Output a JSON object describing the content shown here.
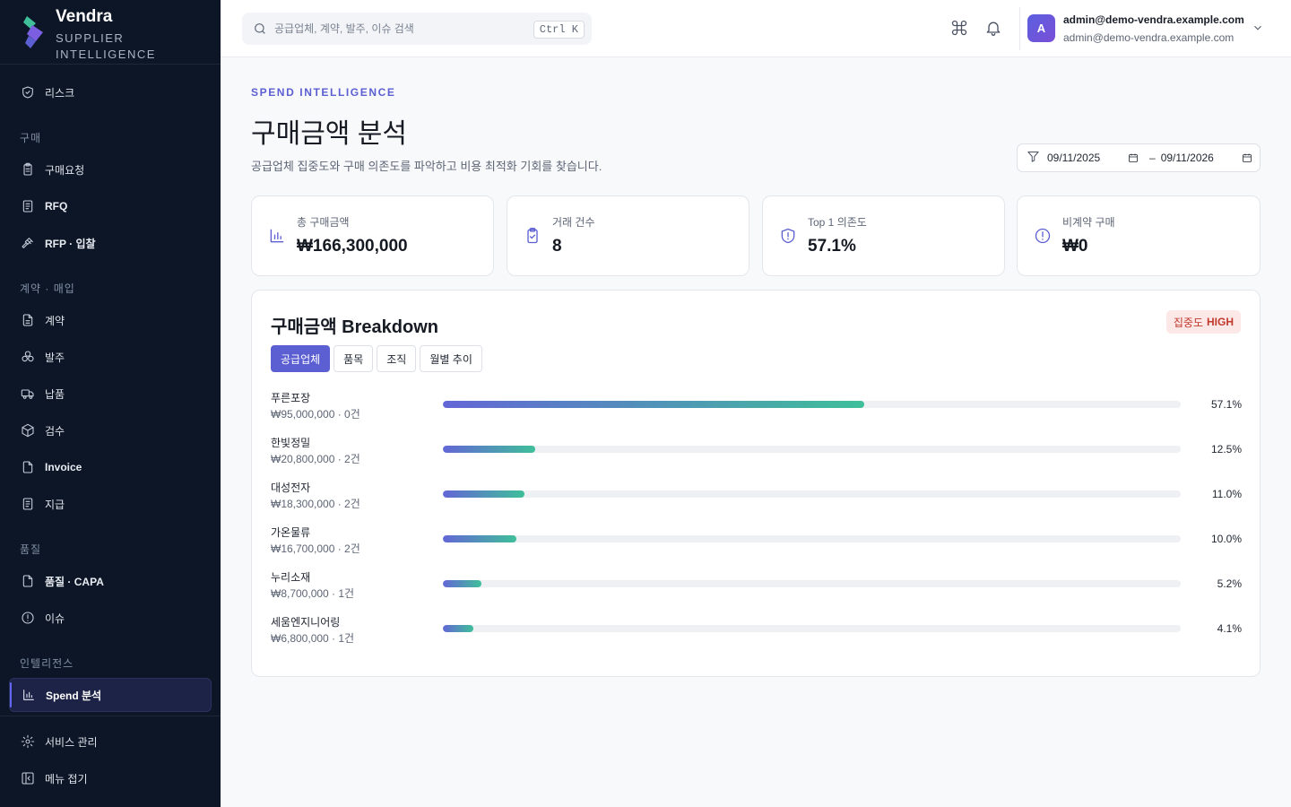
{
  "brand": {
    "name": "Vendra",
    "sub_line1": "SUPPLIER",
    "sub_line2": "INTELLIGENCE"
  },
  "sidebar": {
    "risk": "리스크",
    "sections": {
      "purchase": "구매",
      "contract": "계약 · 매입",
      "quality": "품질",
      "intel": "인텔리전스"
    },
    "items": {
      "purchase_request": "구매요청",
      "rfq": "RFQ",
      "rfp": "RFP · 입찰",
      "contract": "계약",
      "po": "발주",
      "delivery": "납품",
      "inspection": "검수",
      "invoice": "Invoice",
      "payment": "지급",
      "quality_capa": "품질 · CAPA",
      "issue": "이슈",
      "spend": "Spend 분석",
      "service": "서비스 관리",
      "collapse": "메뉴 접기"
    }
  },
  "topbar": {
    "search_placeholder": "공급업체, 계약, 발주, 이슈 검색",
    "shortcut": "Ctrl K",
    "user": {
      "initial": "A",
      "name": "admin@demo-vendra.example.com",
      "email": "admin@demo-vendra.example.com"
    }
  },
  "page": {
    "eyebrow": "SPEND INTELLIGENCE",
    "title": "구매금액 분석",
    "description": "공급업체 집중도와 구매 의존도를 파악하고 비용 최적화 기회를 찾습니다.",
    "date_from": "09/11/2025",
    "date_sep": "–",
    "date_to": "09/11/2026"
  },
  "kpis": [
    {
      "label": "총 구매금액",
      "value": "₩166,300,000",
      "icon": "bar-chart-icon"
    },
    {
      "label": "거래 건수",
      "value": "8",
      "icon": "clipboard-check-icon"
    },
    {
      "label": "Top 1 의존도",
      "value": "57.1%",
      "icon": "shield-alert-icon"
    },
    {
      "label": "비계약 구매",
      "value": "₩0",
      "icon": "alert-circle-icon"
    }
  ],
  "breakdown": {
    "title_prefix": "구매금액",
    "title_bold": "Breakdown",
    "badge_label": "집중도",
    "badge_value": "HIGH",
    "tabs": [
      "공급업체",
      "품목",
      "조직",
      "월별 추이"
    ],
    "active_tab": 0,
    "rows": [
      {
        "name": "푸른포장",
        "sub": "₩95,000,000 · 0건",
        "pct_label": "57.1%",
        "share": 0.571
      },
      {
        "name": "한빛정밀",
        "sub": "₩20,800,000 · 2건",
        "pct_label": "12.5%",
        "share": 0.125
      },
      {
        "name": "대성전자",
        "sub": "₩18,300,000 · 2건",
        "pct_label": "11.0%",
        "share": 0.11
      },
      {
        "name": "가온물류",
        "sub": "₩16,700,000 · 2건",
        "pct_label": "10.0%",
        "share": 0.1
      },
      {
        "name": "누리소재",
        "sub": "₩8,700,000 · 1건",
        "pct_label": "5.2%",
        "share": 0.052
      },
      {
        "name": "세움엔지니어링",
        "sub": "₩6,800,000 · 1건",
        "pct_label": "4.1%",
        "share": 0.041
      }
    ]
  },
  "colors": {
    "accent": "#5b5fd1",
    "sidebar_bg": "#0d1626",
    "bar_start": "#6366d6",
    "bar_end": "#3fbf9a",
    "badge_bg": "#fde8e8",
    "badge_text": "#c0392b"
  }
}
